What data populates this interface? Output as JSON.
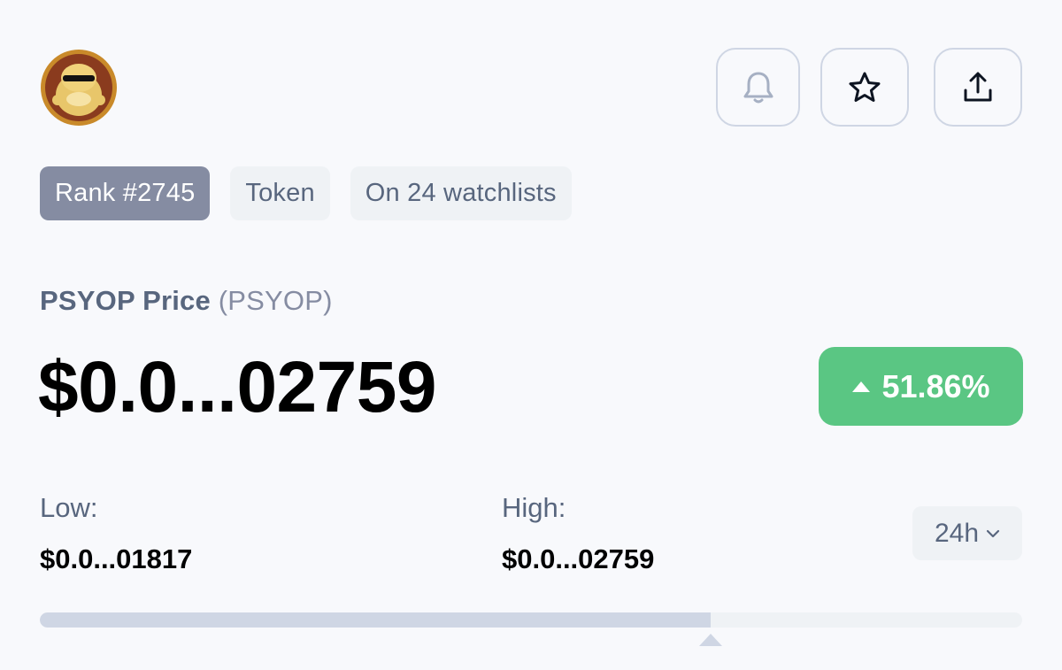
{
  "token": {
    "name": "PSYOP Price",
    "symbol": "(PSYOP)"
  },
  "badges": {
    "rank": "Rank #2745",
    "type": "Token",
    "watchlists": "On 24 watchlists"
  },
  "price": {
    "value": "$0.0...02759",
    "change": "51.86%",
    "change_direction": "up",
    "change_color": "#5ac683"
  },
  "range": {
    "low_label": "Low:",
    "low_value": "$0.0...01817",
    "high_label": "High:",
    "high_value": "$0.0...02759",
    "period": "24h",
    "position_fraction": 0.683
  },
  "icons": {
    "alert": "bell-icon",
    "watchlist": "star-icon",
    "share": "share-icon",
    "period_dropdown": "chevron-down-icon",
    "change_indicator": "caret-up-icon"
  }
}
